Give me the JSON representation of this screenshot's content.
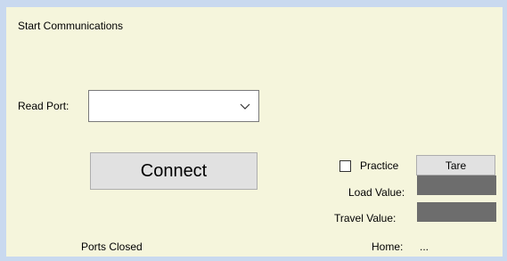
{
  "group": {
    "title": "Start Communications"
  },
  "read_port": {
    "label": "Read Port:",
    "value": ""
  },
  "connect": {
    "label": "Connect"
  },
  "practice": {
    "label": "Practice",
    "checked": false
  },
  "tare": {
    "label": "Tare"
  },
  "load_value": {
    "label": "Load Value:",
    "value": ""
  },
  "travel_value": {
    "label": "Travel Value:",
    "value": ""
  },
  "status": {
    "text": "Ports Closed"
  },
  "home": {
    "label": "Home:",
    "value": "..."
  },
  "icons": {
    "dropdown": "chevron-down-icon"
  },
  "colors": {
    "window_bg": "#c9d9ef",
    "panel_bg": "#f5f5dc",
    "value_box": "#6d6d6d",
    "button_bg": "#e1e1e1"
  }
}
